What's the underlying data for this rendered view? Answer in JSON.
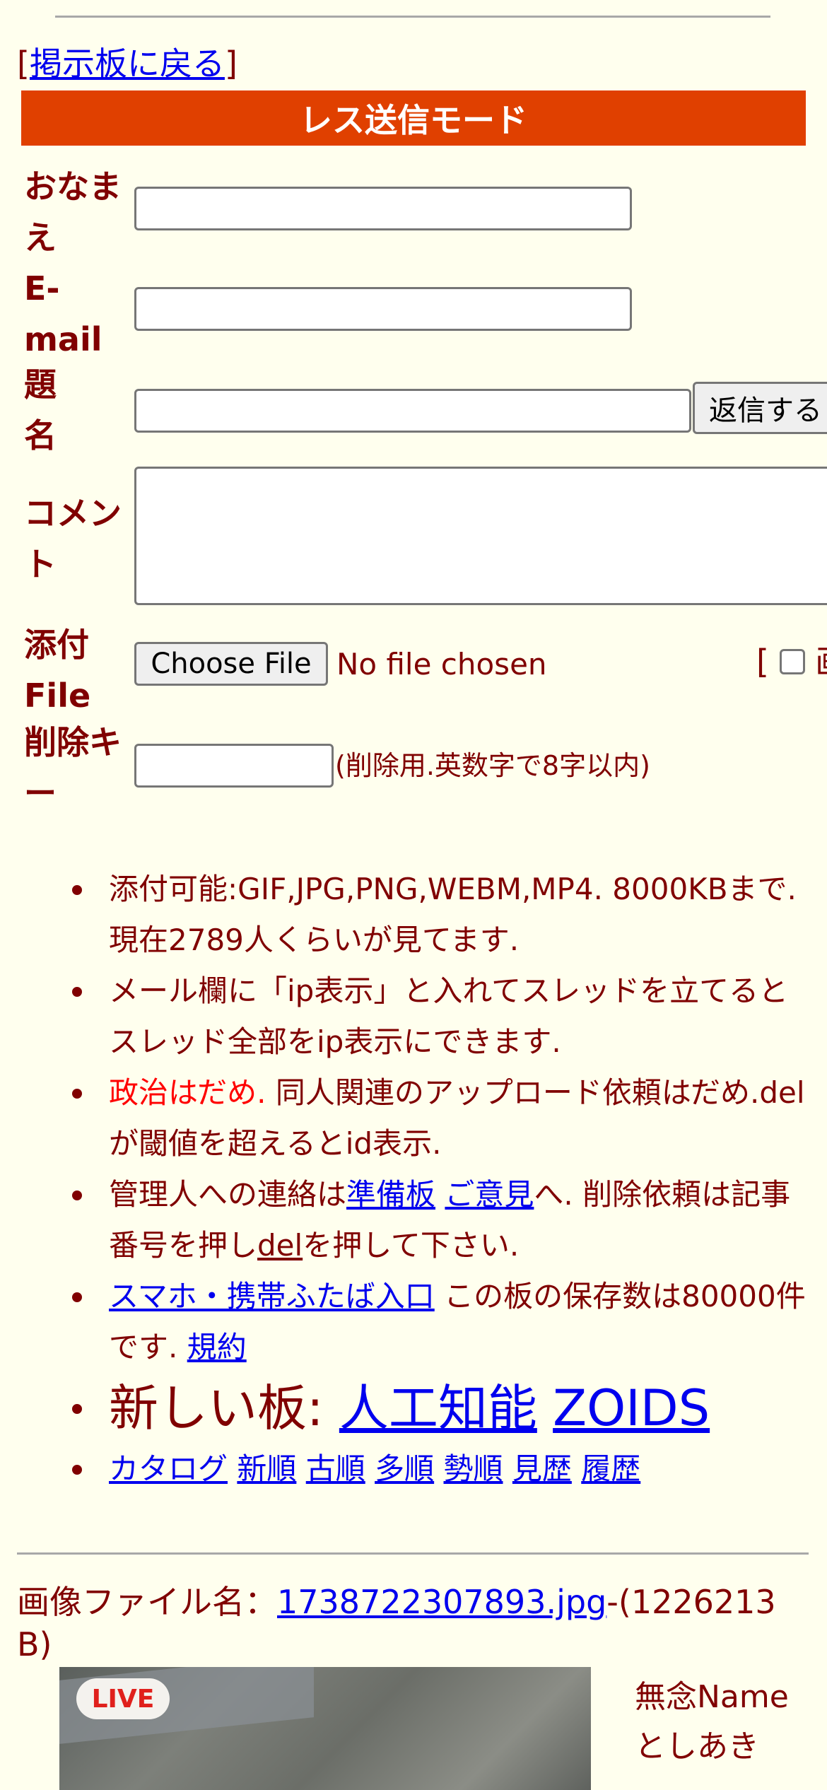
{
  "nav": {
    "back_bracket_open": "[",
    "back_label": "掲示板に戻る",
    "back_bracket_close": "]"
  },
  "form": {
    "title": "レス送信モード",
    "name_label": "おなまえ",
    "email_label": "E-mail",
    "subject_label": "題名",
    "comment_label": "コメント",
    "file_label": "添付File",
    "delkey_label": "削除キー",
    "submit_label": "返信する",
    "choose_file_label": "Choose File",
    "no_file_text": "No file chosen",
    "image_toggle_bracket": "[",
    "image_toggle_char": "画",
    "delkey_hint": "(削除用.英数字で8字以内)"
  },
  "rules": {
    "r1": "添付可能:GIF,JPG,PNG,WEBM,MP4. 8000KBまで. 現在2789人くらいが見てます.",
    "r2": "メール欄に「ip表示」と入れてスレッドを立てるとスレッド全部をip表示にできます.",
    "r3_red": "政治はだめ.",
    "r3_rest": " 同人関連のアップロード依頼はだめ.delが閾値を超えるとid表示.",
    "r4_a": "管理人への連絡は",
    "r4_link1": "準備板",
    "r4_link2": "ご意見",
    "r4_b": "へ. 削除依頼は記事番号を押し",
    "r4_link3": "del",
    "r4_c": "を押して下さい.",
    "r5_link": "スマホ・携帯ふたば入口",
    "r5_a": " この板の保存数は80000件です. ",
    "r5_link2": "規約",
    "r6_a": "新しい板: ",
    "r6_link1": "人工知能",
    "r6_link2": "ZOIDS",
    "sort_links": [
      "カタログ",
      "新順",
      "古順",
      "多順",
      "勢順",
      "見歴",
      "履歴"
    ]
  },
  "post": {
    "filename_label": "画像ファイル名：",
    "filename": "1738722307893.jpg",
    "filesize": "-(1226213 B)",
    "live_badge": "LIVE",
    "name": "無念Name",
    "author": "としあき"
  }
}
